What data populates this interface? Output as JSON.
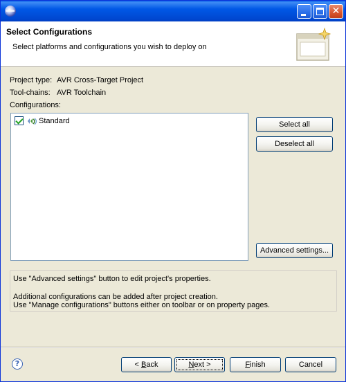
{
  "window": {
    "icon": "eclipse-icon",
    "controls": {
      "minimize": "minimize-icon",
      "maximize": "maximize-icon",
      "close": "close-icon"
    }
  },
  "banner": {
    "title": "Select Configurations",
    "description": "Select platforms and configurations you wish to deploy on",
    "icon": "wizard-banner-icon"
  },
  "project": {
    "type_label": "Project type:",
    "type_value": "AVR Cross-Target Project",
    "toolchains_label": "Tool-chains:",
    "toolchains_value": "AVR Toolchain",
    "configurations_label": "Configurations:"
  },
  "configurations": [
    {
      "label": "Standard",
      "checked": true,
      "icon": "configuration-icon"
    }
  ],
  "buttons": {
    "select_all": "Select all",
    "deselect_all": "Deselect all",
    "advanced": "Advanced settings..."
  },
  "info": {
    "line1": "Use \"Advanced settings\" button to edit project's properties.",
    "line2": "Additional configurations can be added after project creation.",
    "line3": "Use \"Manage configurations\" buttons either on toolbar or on property pages."
  },
  "footer": {
    "help_icon": "help-icon",
    "back_prefix": "< ",
    "back_access": "B",
    "back_rest": "ack",
    "next_access": "N",
    "next_rest": "ext >",
    "finish_access": "F",
    "finish_rest": "inish",
    "cancel": "Cancel"
  },
  "colors": {
    "titlebar": "#0058e6",
    "dialog_bg": "#ece9d8",
    "border_accent": "#003c74",
    "check": "#21a121"
  }
}
